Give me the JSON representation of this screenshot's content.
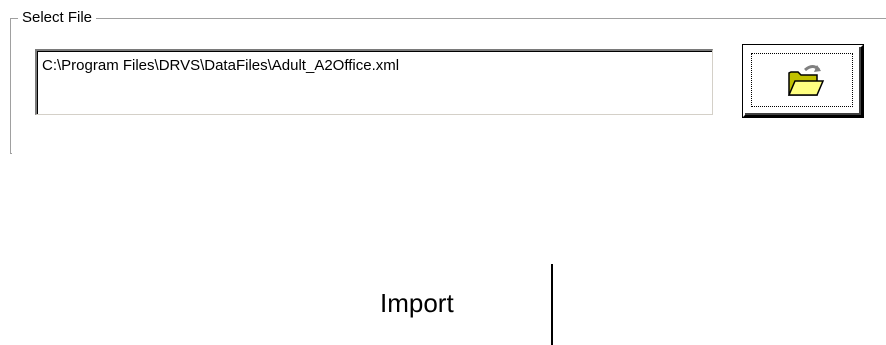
{
  "select_file": {
    "legend": "Select File",
    "path_value": "C:\\Program Files\\DRVS\\DataFiles\\Adult_A2Office.xml",
    "browse_icon": "folder-open-icon"
  },
  "import": {
    "label": "Import"
  },
  "colors": {
    "folder_yellow": "#ffff80",
    "folder_dark": "#808000",
    "arrow_gray": "#808080"
  }
}
